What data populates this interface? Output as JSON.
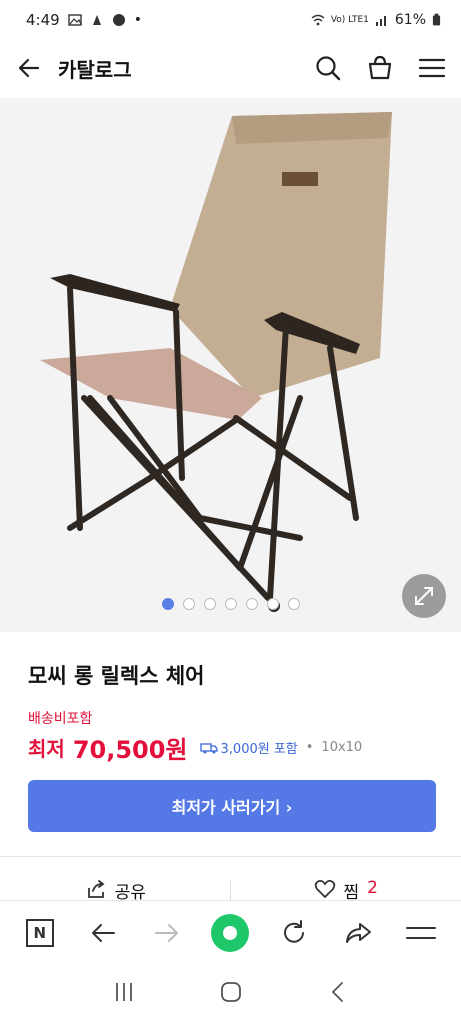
{
  "status": {
    "time": "4:49",
    "battery": "61%",
    "net": "Vo) LTE1"
  },
  "header": {
    "title": "카탈로그"
  },
  "gallery": {
    "dot_count": 7,
    "active_index": 0
  },
  "product": {
    "name": "모씨 롱 릴렉스 체어",
    "shipping_note": "배송비포함",
    "price_label": "최저",
    "price": "70,500원",
    "shipping_fee": "3,000원 포함",
    "size": "10x10",
    "cta_label": "최저가 사러가기 ›"
  },
  "actions": {
    "share_label": "공유",
    "zzim_label": "찜",
    "zzim_count": "2"
  },
  "colors": {
    "accent": "#5479e6",
    "price": "#e2103a",
    "green": "#1ec76a"
  }
}
